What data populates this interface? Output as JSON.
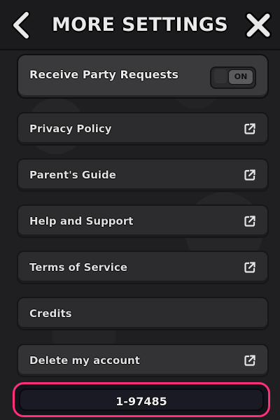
{
  "header": {
    "title": "MORE SETTINGS",
    "back_icon": "chevron-left-icon",
    "close_icon": "close-icon"
  },
  "party_requests": {
    "label": "Receive Party Requests",
    "toggle_state": "ON"
  },
  "menu": [
    {
      "label": "Privacy Policy",
      "icon": "external-link-icon"
    },
    {
      "label": "Parent's Guide",
      "icon": "external-link-icon"
    },
    {
      "label": "Help and Support",
      "icon": "external-link-icon"
    },
    {
      "label": "Terms of Service",
      "icon": "external-link-icon"
    },
    {
      "label": "Credits",
      "icon": ""
    },
    {
      "label": "Delete my account",
      "icon": "external-link-icon"
    }
  ],
  "player_id": "1-97485",
  "colors": {
    "accent_pink": "#ff2f7a",
    "background": "#1f1f22",
    "card": "#2c2c2f"
  }
}
